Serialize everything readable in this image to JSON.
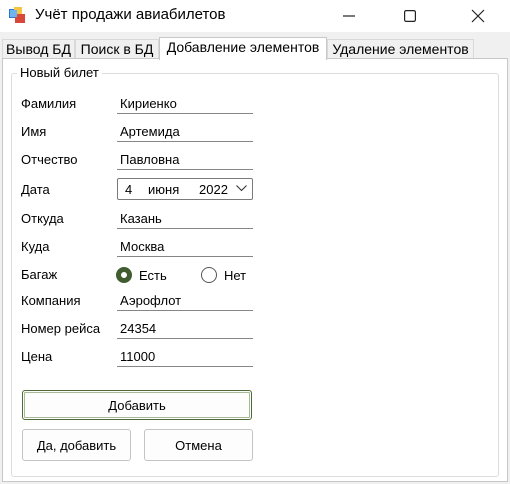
{
  "window": {
    "title": "Учёт продажи авиабилетов",
    "icon": "app-icon",
    "controls": [
      "minimize-icon",
      "maximize-icon",
      "close-icon"
    ]
  },
  "tabs": [
    {
      "label": "Вывод БД",
      "active": false
    },
    {
      "label": "Поиск в БД",
      "active": false
    },
    {
      "label": "Добавление элементов",
      "active": true
    },
    {
      "label": "Удаление элементов",
      "active": false
    }
  ],
  "group": {
    "title": "Новый билет"
  },
  "fields": {
    "surname": {
      "label": "Фамилия",
      "value": "Кириенко"
    },
    "name": {
      "label": "Имя",
      "value": "Артемида"
    },
    "patronymic": {
      "label": "Отчество",
      "value": "Павловна"
    },
    "date": {
      "label": "Дата",
      "day": "4",
      "month": "июня",
      "year": "2022"
    },
    "from": {
      "label": "Откуда",
      "value": "Казань"
    },
    "to": {
      "label": "Куда",
      "value": "Москва"
    },
    "baggage": {
      "label": "Багаж",
      "options": [
        "Есть",
        "Нет"
      ],
      "selected": "Есть"
    },
    "company": {
      "label": "Компания",
      "value": "Аэрофлот"
    },
    "flight": {
      "label": "Номер рейса",
      "value": "24354"
    },
    "price": {
      "label": "Цена",
      "value": "11000"
    }
  },
  "buttons": {
    "add": "Добавить",
    "yes_add": "Да, добавить",
    "cancel": "Отмена"
  },
  "colors": {
    "radio_selected": "#3f5d2e",
    "primary_button_border": "#4e6b35"
  }
}
